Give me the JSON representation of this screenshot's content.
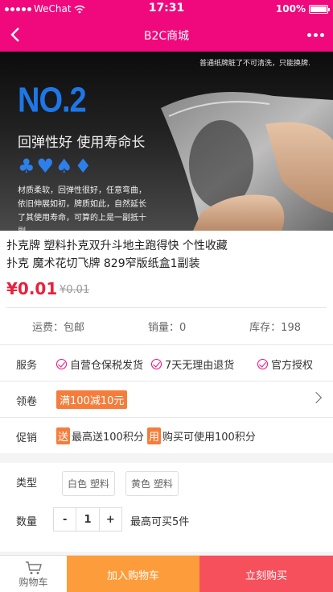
{
  "status": {
    "carrier": "WeChat",
    "time": "17:31",
    "battery": "100%",
    "battery_level": 1.0
  },
  "nav": {
    "title": "B2C商城",
    "back_icon": "chevron-left-icon",
    "more_icon": "more-dots-icon"
  },
  "hero": {
    "top_note": "普通纸牌脏了不可清洗，只能换牌.",
    "heading": "NO.2",
    "slogan": "回弹性好 使用寿命长",
    "suits": "♣♥♠♦",
    "desc": "材质柔软，回弹性很好，任意弯曲，依旧伸展如初，牌质如此，自然延长了其使用寿命，可算的上是一副抵十副。"
  },
  "product": {
    "title_line1": "扑克牌 塑料扑克双升斗地主跑得快 个性收藏",
    "title_line2": "扑克 魔术花切飞牌 829窄版纸盒1副装",
    "price": "¥0.01",
    "old_price": "¥0.01"
  },
  "stats": {
    "shipping": "运费：包邮",
    "sales": "销量：0",
    "stock": "库存：198"
  },
  "service": {
    "label": "服务",
    "items": [
      "自营仓保税发货",
      "7天无理由退货",
      "官方授权"
    ]
  },
  "coupon": {
    "label": "领卷",
    "text": "满100减10元"
  },
  "promo": {
    "label": "促销",
    "items": [
      {
        "tag": "送",
        "text": "最高送100积分"
      },
      {
        "tag": "用",
        "text": "购买可使用100积分"
      }
    ]
  },
  "type": {
    "label": "类型",
    "options": [
      "白色 塑料",
      "黄色 塑料"
    ]
  },
  "quantity": {
    "label": "数量",
    "minus": "-",
    "value": "1",
    "plus": "+",
    "limit": "最高可买5件"
  },
  "bottom": {
    "cart": "购物车",
    "add_to_cart": "加入购物车",
    "buy_now": "立刻购买"
  },
  "colors": {
    "brand": "#f0087d",
    "price": "#e8213c",
    "add_to_cart": "#fd9c3a",
    "buy_now": "#f6505c",
    "tag": "#f57d3c"
  }
}
